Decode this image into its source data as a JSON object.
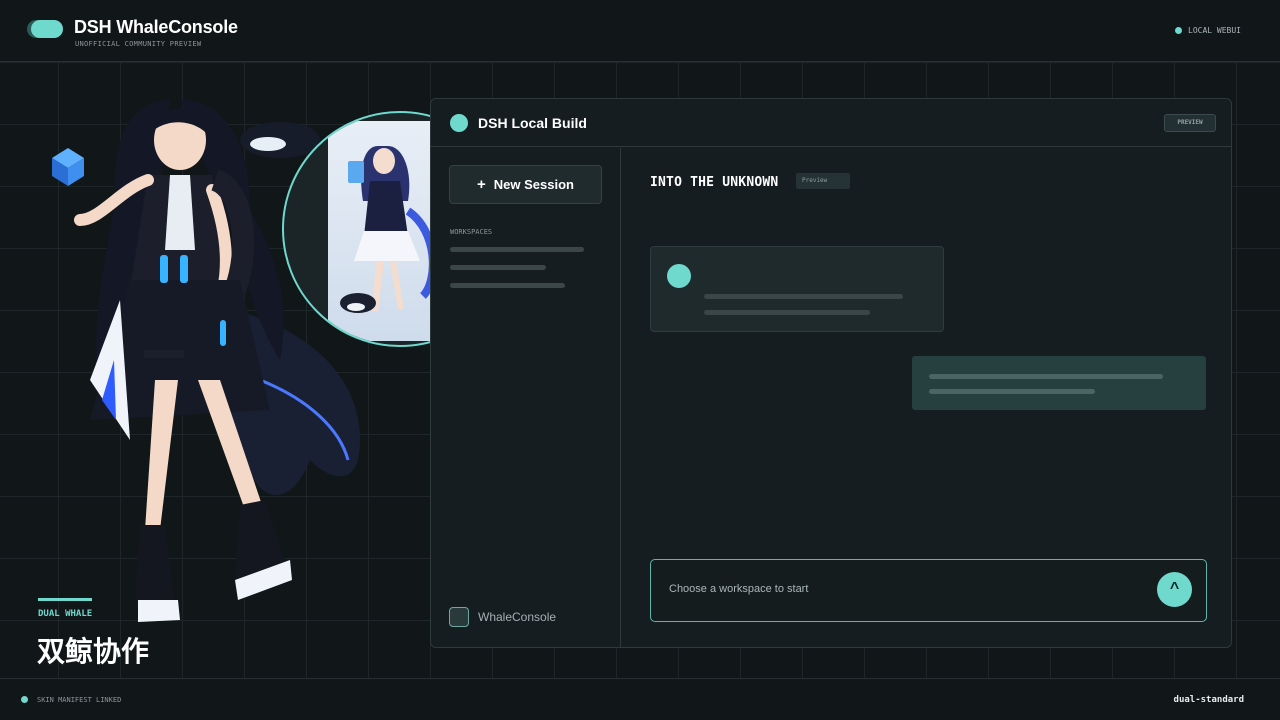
{
  "header": {
    "brand_title": "DSH WhaleConsole",
    "brand_subtitle": "UNOFFICIAL COMMUNITY PREVIEW",
    "status_label": "LOCAL WEBUI"
  },
  "caption": {
    "label": "DUAL WHALE",
    "title": "双鲸协作"
  },
  "window": {
    "title": "DSH Local Build",
    "badge": "PREVIEW",
    "sidebar": {
      "new_session_label": "New Session",
      "workspaces_label": "WORKSPACES",
      "footer_label": "WhaleConsole"
    },
    "main": {
      "title": "INTO THE UNKNOWN",
      "badge": "Preview",
      "composer_placeholder": "Choose a workspace to start",
      "send_glyph": "^"
    }
  },
  "footer": {
    "left_label": "SKIN MANIFEST LINKED",
    "right_label": "dual-standard"
  },
  "colors": {
    "accent": "#6fd9cd",
    "background": "#111719",
    "panel": "#161d20"
  },
  "icons": {
    "logo": "whale-logo-icon",
    "status": "status-dot-icon",
    "new_session": "plus-icon",
    "send": "send-arrow-icon"
  }
}
